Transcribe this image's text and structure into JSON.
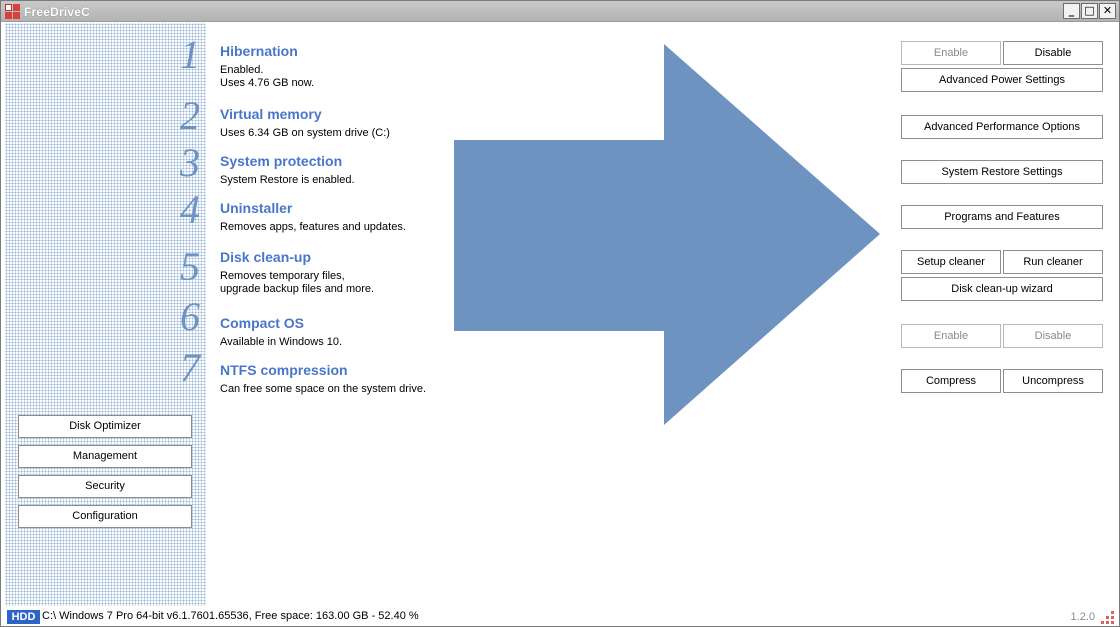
{
  "window": {
    "title": "FreeDriveC",
    "controls": {
      "minimize": "_",
      "maximize": "□",
      "close": "✕"
    }
  },
  "steps": [
    {
      "number": "1",
      "title": "Hibernation",
      "description": [
        "Enabled.",
        "Uses 4.76 GB now."
      ]
    },
    {
      "number": "2",
      "title": "Virtual memory",
      "description": [
        "Uses 6.34 GB on system drive (C:)"
      ]
    },
    {
      "number": "3",
      "title": "System protection",
      "description": [
        "System Restore is enabled."
      ]
    },
    {
      "number": "4",
      "title": "Uninstaller",
      "description": [
        "Removes apps, features and updates."
      ]
    },
    {
      "number": "5",
      "title": "Disk clean-up",
      "description": [
        "Removes temporary files,",
        "upgrade backup files and more."
      ]
    },
    {
      "number": "6",
      "title": "Compact OS",
      "description": [
        "Available in Windows 10."
      ]
    },
    {
      "number": "7",
      "title": "NTFS compression",
      "description": [
        "Can free some space on the system drive."
      ]
    }
  ],
  "actions": {
    "hibernation_enable": "Enable",
    "hibernation_disable": "Disable",
    "advanced_power": "Advanced Power Settings",
    "advanced_performance": "Advanced Performance Options",
    "system_restore": "System Restore Settings",
    "programs_features": "Programs and Features",
    "setup_cleaner": "Setup cleaner",
    "run_cleaner": "Run cleaner",
    "disk_cleanup_wizard": "Disk clean-up wizard",
    "compactos_enable": "Enable",
    "compactos_disable": "Disable",
    "compress": "Compress",
    "uncompress": "Uncompress"
  },
  "sidebar": {
    "buttons": [
      "Disk Optimizer",
      "Management",
      "Security",
      "Configuration"
    ]
  },
  "status": {
    "drive_type": "HDD",
    "info": "C:\\ Windows 7 Pro  64-bit v6.1.7601.65536, Free space: 163.00 GB - 52.40 %",
    "version": "1.2.0"
  },
  "colors": {
    "accent": "#4a76c9",
    "arrow": "#6f93c0",
    "hdd_badge": "#2e64c7"
  }
}
